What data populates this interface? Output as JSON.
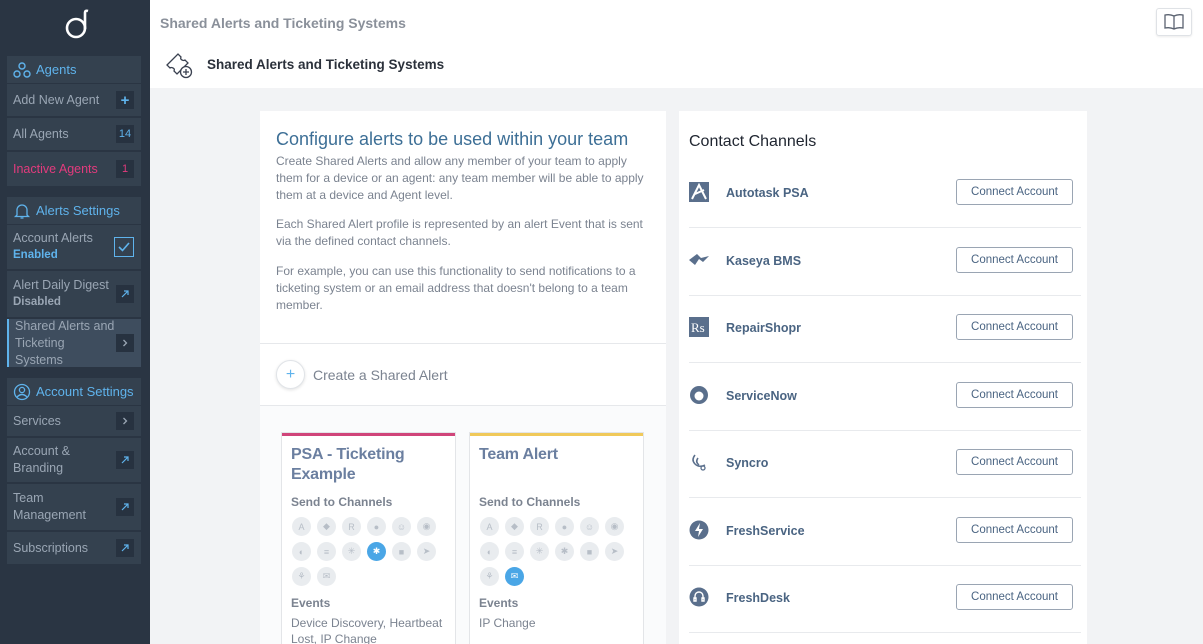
{
  "colors": {
    "sidebar": "#2a3543",
    "accent": "#5fb3ec",
    "danger": "#e23b7d",
    "psa_bar": "#d0457a",
    "team_bar": "#f0c95a"
  },
  "sidebar": {
    "agents_header": "Agents",
    "add_new_agent": "Add New Agent",
    "add_new_agent_badge": "+",
    "all_agents": "All Agents",
    "all_agents_count": "14",
    "inactive_agents": "Inactive Agents",
    "inactive_agents_count": "1",
    "alerts_header": "Alerts Settings",
    "account_alerts": "Account Alerts",
    "account_alerts_status": "Enabled",
    "daily_digest": "Alert Daily Digest",
    "daily_digest_status": "Disabled",
    "shared_alerts": "Shared Alerts and Ticketing Systems",
    "account_header": "Account Settings",
    "services": "Services",
    "account_branding": "Account & Branding",
    "team_management": "Team Management",
    "subscriptions": "Subscriptions"
  },
  "header": {
    "breadcrumb": "Shared Alerts and Ticketing Systems",
    "page_title": "Shared Alerts and Ticketing Systems"
  },
  "configure": {
    "title": "Configure alerts to be used within your team",
    "para1": "Create Shared Alerts and allow any member of your team to apply them for a device or an agent: any team member will be able to apply them at a device and Agent level.",
    "para2": "Each Shared Alert profile is represented by an alert Event that is sent via the defined contact channels.",
    "para3": "For example, you can use this functionality to send notifications to a ticketing system or an email address that doesn't belong to a team member.",
    "create_label": "Create a Shared Alert"
  },
  "alert_cards": [
    {
      "title": "PSA - Ticketing Example",
      "send_label": "Send to Channels",
      "events_label": "Events",
      "events": "Device Discovery, Heartbeat Lost, IP Change"
    },
    {
      "title": "Team Alert",
      "send_label": "Send to Channels",
      "events_label": "Events",
      "events": "IP Change"
    }
  ],
  "contact_channels": {
    "title": "Contact Channels",
    "items": [
      {
        "name": "Autotask PSA",
        "icon": "autotask-icon",
        "button": "Connect Account"
      },
      {
        "name": "Kaseya BMS",
        "icon": "kaseya-icon",
        "button": "Connect Account"
      },
      {
        "name": "RepairShopr",
        "icon": "repairshopr-icon",
        "button": "Connect Account"
      },
      {
        "name": "ServiceNow",
        "icon": "servicenow-icon",
        "button": "Connect Account"
      },
      {
        "name": "Syncro",
        "icon": "syncro-icon",
        "button": "Connect Account"
      },
      {
        "name": "FreshService",
        "icon": "freshservice-icon",
        "button": "Connect Account"
      },
      {
        "name": "FreshDesk",
        "icon": "freshdesk-icon",
        "button": "Connect Account"
      }
    ]
  }
}
